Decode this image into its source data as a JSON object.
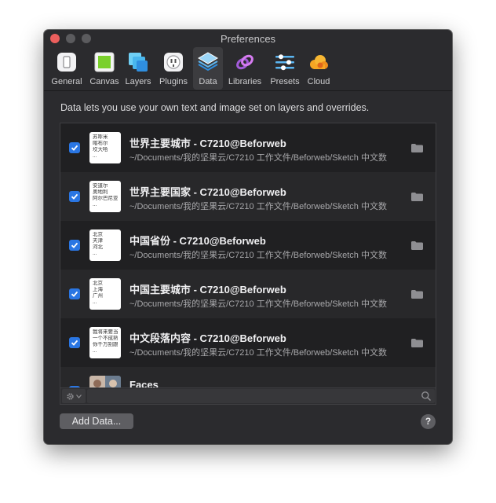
{
  "window": {
    "title": "Preferences"
  },
  "toolbar": {
    "tabs": [
      {
        "label": "General",
        "icon": "general-icon"
      },
      {
        "label": "Canvas",
        "icon": "canvas-icon"
      },
      {
        "label": "Layers",
        "icon": "layers-icon"
      },
      {
        "label": "Plugins",
        "icon": "plugins-icon"
      },
      {
        "label": "Data",
        "icon": "data-icon",
        "active": true
      },
      {
        "label": "Libraries",
        "icon": "libraries-icon"
      },
      {
        "label": "Presets",
        "icon": "presets-icon"
      },
      {
        "label": "Cloud",
        "icon": "cloud-icon"
      }
    ]
  },
  "description": "Data lets you use your own text and image set on layers and overrides.",
  "data_sources": [
    {
      "checked": true,
      "title": "世界主要城市 - C7210@Beforweb",
      "path": "~/Documents/我的坚果云/C7210 工作文件/Beforweb/Sketch 中文数",
      "thumb": [
        "苏呼米",
        "喀布尔",
        "坎大哈",
        "..."
      ]
    },
    {
      "checked": true,
      "title": "世界主要国家 - C7210@Beforweb",
      "path": "~/Documents/我的坚果云/C7210 工作文件/Beforweb/Sketch 中文数",
      "thumb": [
        "安道尔",
        "奥地利",
        "阿尔巴尼亚",
        "..."
      ]
    },
    {
      "checked": true,
      "title": "中国省份 - C7210@Beforweb",
      "path": "~/Documents/我的坚果云/C7210 工作文件/Beforweb/Sketch 中文数",
      "thumb": [
        "北京",
        "天津",
        "河北",
        "..."
      ]
    },
    {
      "checked": true,
      "title": "中国主要城市 - C7210@Beforweb",
      "path": "~/Documents/我的坚果云/C7210 工作文件/Beforweb/Sketch 中文数",
      "thumb": [
        "北京",
        "上海",
        "广州",
        "..."
      ]
    },
    {
      "checked": true,
      "title": "中文段落内容 - C7210@Beforweb",
      "path": "~/Documents/我的坚果云/C7210 工作文件/Beforweb/Sketch 中文数",
      "thumb": [
        "我将来要当",
        "一个不成熟",
        "你千万别跟",
        "..."
      ]
    },
    {
      "checked": true,
      "title": "Faces",
      "path": "",
      "thumb": []
    }
  ],
  "buttons": {
    "add_data": "Add Data...",
    "help": "?"
  },
  "colors": {
    "accent": "#2a76e3",
    "close": "#ec5f5d"
  }
}
